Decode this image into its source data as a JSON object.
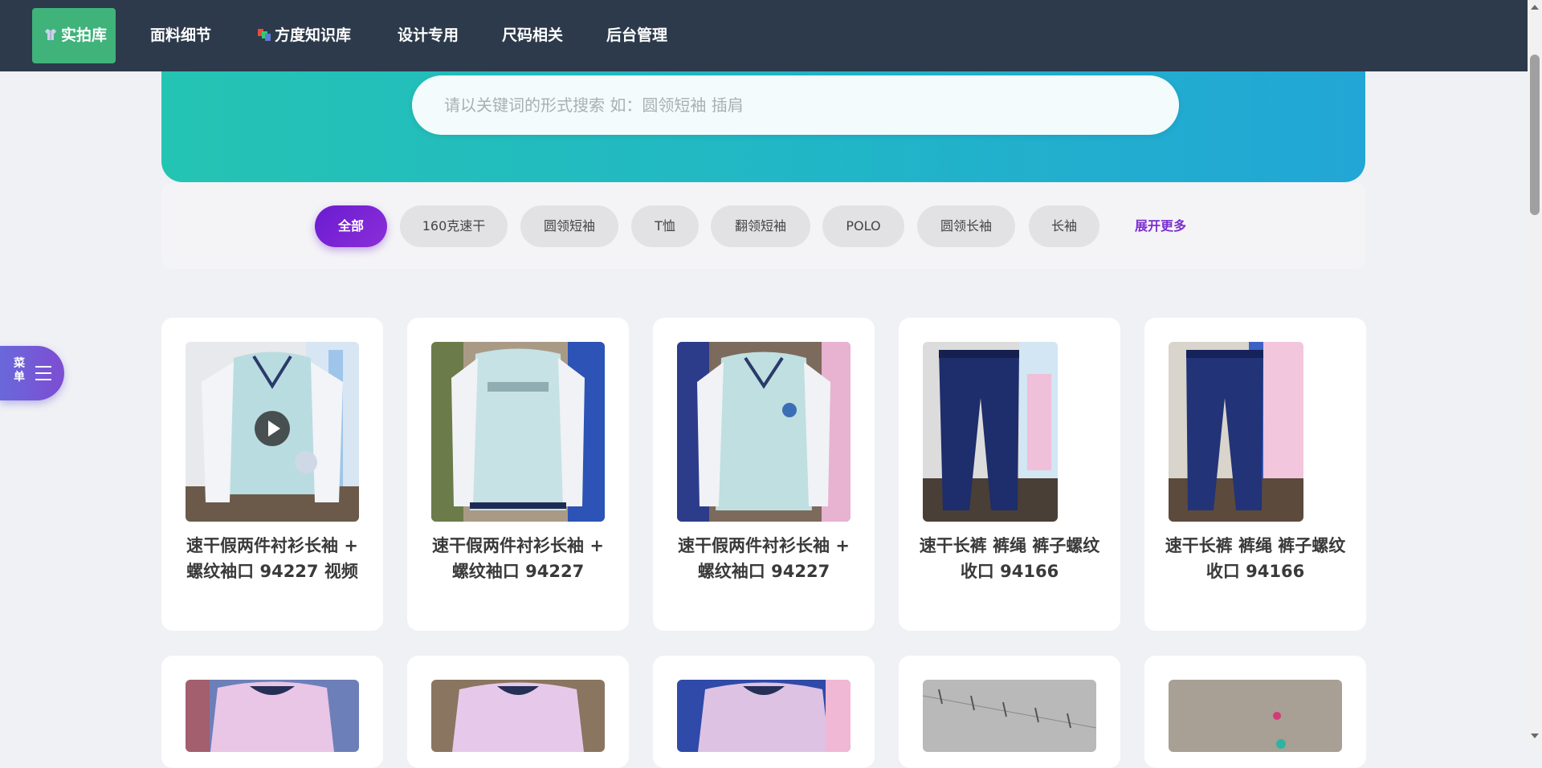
{
  "nav": {
    "items": [
      {
        "label": "实拍库",
        "icon": "shirt-icon",
        "active": true
      },
      {
        "label": "面料细节"
      },
      {
        "label": "方度知识库",
        "icon": "books-icon"
      },
      {
        "label": "设计专用"
      },
      {
        "label": "尺码相关"
      },
      {
        "label": "后台管理"
      }
    ]
  },
  "search": {
    "placeholder": "请以关键词的形式搜索 如：圆领短袖 插肩"
  },
  "filters": {
    "chips": [
      "全部",
      "160克速干",
      "圆领短袖",
      "T恤",
      "翻领短袖",
      "POLO",
      "圆领长袖",
      "长袖"
    ],
    "active_index": 0,
    "expand_label": "展开更多"
  },
  "side_menu": {
    "label": "菜单",
    "icon": "hamburger-icon"
  },
  "cards": [
    {
      "title": "速干假两件衬衫长袖 + 螺纹袖口 94227 视频",
      "has_video": true
    },
    {
      "title": "速干假两件衬衫长袖 + 螺纹袖口 94227"
    },
    {
      "title": "速干假两件衬衫长袖 + 螺纹袖口 94227"
    },
    {
      "title": "速干长裤 裤绳 裤子螺纹收口 94166"
    },
    {
      "title": "速干长裤 裤绳 裤子螺纹收口 94166"
    }
  ],
  "colors": {
    "nav_bg": "#2c3a4b",
    "nav_active": "#3fb37a",
    "hero_gradient_start": "#24c4b3",
    "hero_gradient_end": "#22a6d6",
    "chip_active": "#6a1bd1",
    "expand_link": "#7b2fd0",
    "side_menu": "#6a68db"
  }
}
